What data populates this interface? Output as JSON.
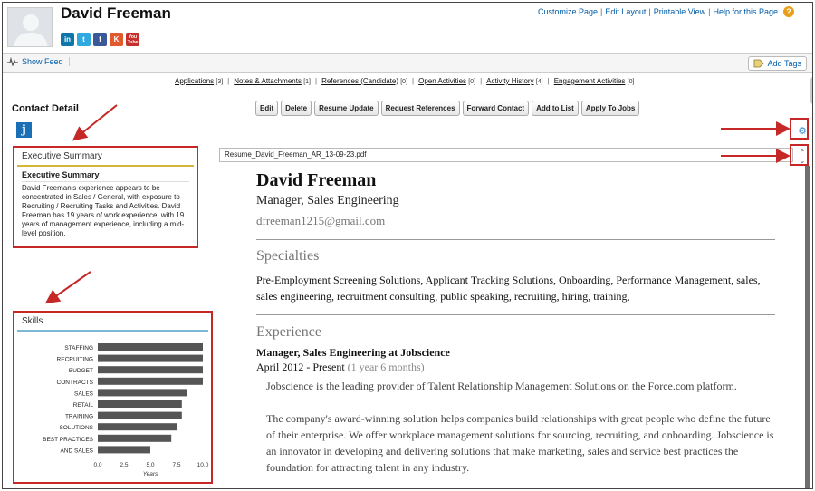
{
  "contact": {
    "name": "David Freeman",
    "social": [
      "in",
      "t",
      "f",
      "K",
      "You Tube"
    ]
  },
  "toplinks": [
    "Customize Page",
    "Edit Layout",
    "Printable View",
    "Help for this Page"
  ],
  "feed": {
    "show_feed": "Show Feed",
    "add_tags": "Add Tags"
  },
  "related": [
    {
      "label": "Applications",
      "count": "[3]"
    },
    {
      "label": "Notes & Attachments",
      "count": "[1]"
    },
    {
      "label": "References (Candidate)",
      "count": "[0]"
    },
    {
      "label": "Open Activities",
      "count": "[0]"
    },
    {
      "label": "Activity History",
      "count": "[4]"
    },
    {
      "label": "Engagement Activities",
      "count": "[0]"
    }
  ],
  "detail": {
    "title": "Contact Detail",
    "j_icon": "j",
    "buttons": [
      "Edit",
      "Delete",
      "Resume Update",
      "Request References",
      "Forward Contact",
      "Add to List",
      "Apply To Jobs"
    ]
  },
  "exec_summary": {
    "panel_title": "Executive Summary",
    "subtitle": "Executive Summary",
    "text": "David Freeman's experience appears to be concentrated in Sales / General, with exposure to Recruiting / Recruiting Tasks and Activities. David Freeman has 19 years of work experience, with 19 years of management experience, including a mid-level position."
  },
  "skills": {
    "panel_title": "Skills"
  },
  "chart_data": {
    "type": "bar",
    "orientation": "horizontal",
    "categories": [
      "STAFFING",
      "RECRUITING",
      "BUDGET",
      "CONTRACTS",
      "SALES",
      "RETAIL",
      "TRAINING",
      "SOLUTIONS",
      "BEST PRACTICES",
      "AND SALES"
    ],
    "values": [
      10,
      10,
      10,
      10,
      8.5,
      8,
      8,
      7.5,
      7,
      5
    ],
    "xlabel": "Years",
    "ylabel": "",
    "xlim": [
      0,
      10
    ],
    "ticks": [
      "0.0",
      "2.5",
      "5.0",
      "7.5",
      "10.0"
    ],
    "bar_color": "#555555"
  },
  "resume": {
    "filename": "Resume_David_Freeman_AR_13-09-23.pdf",
    "name": "David Freeman",
    "title": "Manager, Sales Engineering",
    "email": "dfreeman1215@gmail.com",
    "specialties_heading": "Specialties",
    "specialties": "Pre-Employment Screening Solutions, Applicant Tracking Solutions, Onboarding, Performance Management, sales, sales engineering, recruitment consulting, public speaking, recruiting, hiring, training,",
    "experience_heading": "Experience",
    "job": "Manager, Sales Engineering  at   Jobscience",
    "date": "April 2012  -  Present",
    "duration": "(1 year 6 months)",
    "para1": "Jobscience is the leading provider of Talent Relationship Management Solutions on the Force.com platform.",
    "para2": "The company's award-winning solution helps companies build relationships with great people who define the future of their enterprise. We offer workplace management solutions for sourcing, recruiting, and onboarding. Jobscience is an innovator in developing and delivering solutions that make marketing, sales and service best practices the foundation for attracting talent in any industry."
  },
  "colors": {
    "accent": "#c62828",
    "link": "#015ba7",
    "exec_rule": "#d4b73a",
    "skills_rule": "#7ab8d6"
  }
}
